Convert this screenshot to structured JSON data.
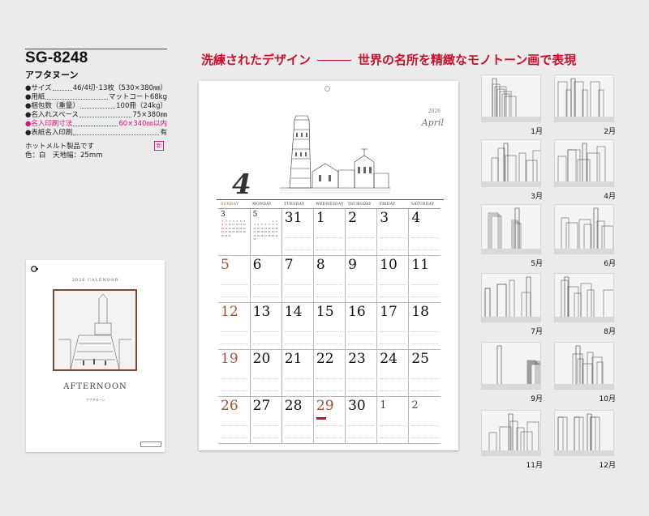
{
  "product": {
    "code": "SG-8248",
    "name": "アフタヌーン"
  },
  "specs": [
    {
      "label": "●サイズ",
      "value": "46/4切･13枚（530×380㎜）",
      "pink": false
    },
    {
      "label": "●用紙",
      "value": "マットコート68kg",
      "pink": false
    },
    {
      "label": "●梱包数（重量）",
      "value": "100冊（24kg）",
      "pink": false
    },
    {
      "label": "●名入れスペース",
      "value": "75×380㎜",
      "pink": false
    },
    {
      "label": "●名入印刷寸法",
      "value": "60×340㎜以内",
      "pink": true
    },
    {
      "label": "●表紙名入印刷",
      "value": "有",
      "pink": false
    }
  ],
  "notes": [
    "ホットメルト製品です",
    "色：白　天地幅：25mm"
  ],
  "new_badge": "新",
  "headline": {
    "main": "洗練されたデザイン",
    "sub": "世界の名所を精緻なモノトーン画で表現"
  },
  "cover": {
    "title": "2026 CALENDAR",
    "name_en": "AFTERNOON",
    "name_jp": "アフタヌーン"
  },
  "calendar": {
    "year": "2026",
    "month_name": "April",
    "month_number": "4",
    "weekdays": [
      "SUNDAY",
      "MONDAY",
      "TUESDAY",
      "WEDNESDAY",
      "THURSDAY",
      "FRIDAY",
      "SATURDAY"
    ],
    "weeks": [
      [
        {
          "d": "3",
          "kind": "mini"
        },
        {
          "d": "5",
          "kind": "mini"
        },
        {
          "d": "31",
          "kind": "normal"
        },
        {
          "d": "1",
          "kind": "normal"
        },
        {
          "d": "2",
          "kind": "normal"
        },
        {
          "d": "3",
          "kind": "normal"
        },
        {
          "d": "4",
          "kind": "normal"
        }
      ],
      [
        {
          "d": "5",
          "kind": "sun"
        },
        {
          "d": "6",
          "kind": "normal"
        },
        {
          "d": "7",
          "kind": "normal"
        },
        {
          "d": "8",
          "kind": "normal"
        },
        {
          "d": "9",
          "kind": "normal"
        },
        {
          "d": "10",
          "kind": "normal"
        },
        {
          "d": "11",
          "kind": "normal"
        }
      ],
      [
        {
          "d": "12",
          "kind": "sun"
        },
        {
          "d": "13",
          "kind": "normal"
        },
        {
          "d": "14",
          "kind": "normal"
        },
        {
          "d": "15",
          "kind": "normal"
        },
        {
          "d": "16",
          "kind": "normal"
        },
        {
          "d": "17",
          "kind": "normal"
        },
        {
          "d": "18",
          "kind": "normal"
        }
      ],
      [
        {
          "d": "19",
          "kind": "sun"
        },
        {
          "d": "20",
          "kind": "normal"
        },
        {
          "d": "21",
          "kind": "normal"
        },
        {
          "d": "22",
          "kind": "normal"
        },
        {
          "d": "23",
          "kind": "normal"
        },
        {
          "d": "24",
          "kind": "normal"
        },
        {
          "d": "25",
          "kind": "normal"
        }
      ],
      [
        {
          "d": "26",
          "kind": "sun"
        },
        {
          "d": "27",
          "kind": "normal"
        },
        {
          "d": "28",
          "kind": "normal"
        },
        {
          "d": "29",
          "kind": "hol"
        },
        {
          "d": "30",
          "kind": "normal"
        },
        {
          "d": "1",
          "kind": "gray"
        },
        {
          "d": "2",
          "kind": "gray"
        }
      ]
    ]
  },
  "thumbnails": [
    "1月",
    "2月",
    "3月",
    "4月",
    "5月",
    "6月",
    "7月",
    "8月",
    "9月",
    "10月",
    "11月",
    "12月"
  ],
  "colors": {
    "accent": "#c8102e",
    "pink": "#e0147a",
    "sunday": "#a0523a"
  }
}
